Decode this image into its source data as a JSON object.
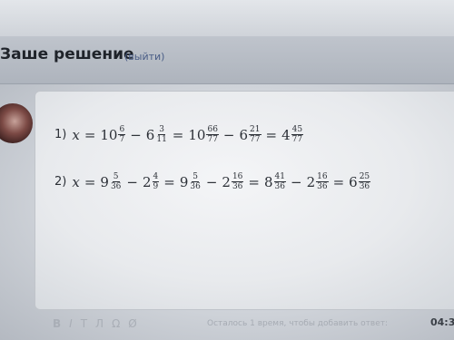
{
  "header": {
    "title": "Заше решение",
    "exit_link": "(выйти)"
  },
  "solution": {
    "line1": {
      "number": "1)",
      "variable": "x",
      "terms": [
        {
          "op": "=",
          "whole": "10",
          "num": "6",
          "den": "7"
        },
        {
          "op": "−",
          "whole": "6",
          "num": "3",
          "den": "11"
        },
        {
          "op": "=",
          "whole": "10",
          "num": "66",
          "den": "77"
        },
        {
          "op": "−",
          "whole": "6",
          "num": "21",
          "den": "77"
        },
        {
          "op": "=",
          "whole": "4",
          "num": "45",
          "den": "77"
        }
      ]
    },
    "line2": {
      "number": "2)",
      "variable": "x",
      "terms": [
        {
          "op": "=",
          "whole": "9",
          "num": "5",
          "den": "36"
        },
        {
          "op": "−",
          "whole": "2",
          "num": "4",
          "den": "9"
        },
        {
          "op": "=",
          "whole": "9",
          "num": "5",
          "den": "36"
        },
        {
          "op": "−",
          "whole": "2",
          "num": "16",
          "den": "36"
        },
        {
          "op": "=",
          "whole": "8",
          "num": "41",
          "den": "36"
        },
        {
          "op": "−",
          "whole": "2",
          "num": "16",
          "den": "36"
        },
        {
          "op": "=",
          "whole": "6",
          "num": "25",
          "den": "36"
        }
      ]
    }
  },
  "toolbar": {
    "items": [
      "B",
      "I",
      "T",
      "Л",
      "Ω",
      "Ø"
    ],
    "hint": "Осталось 1 время, чтобы добавить ответ:",
    "timer": "04:3"
  }
}
